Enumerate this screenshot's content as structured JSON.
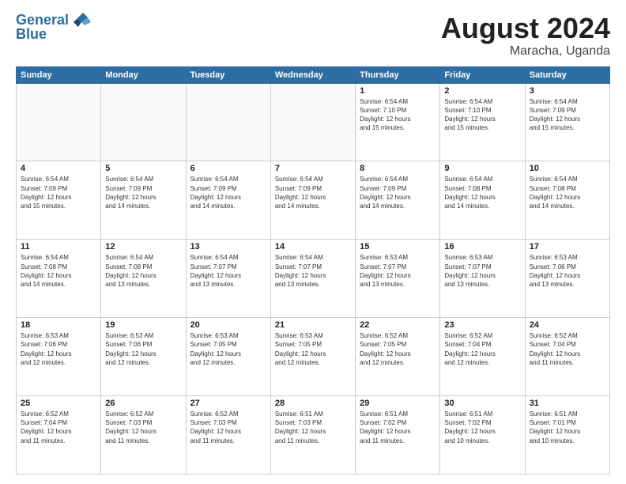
{
  "header": {
    "logo_line1": "General",
    "logo_line2": "Blue",
    "title": "August 2024",
    "subtitle": "Maracha, Uganda"
  },
  "weekdays": [
    "Sunday",
    "Monday",
    "Tuesday",
    "Wednesday",
    "Thursday",
    "Friday",
    "Saturday"
  ],
  "weeks": [
    [
      {
        "day": "",
        "info": ""
      },
      {
        "day": "",
        "info": ""
      },
      {
        "day": "",
        "info": ""
      },
      {
        "day": "",
        "info": ""
      },
      {
        "day": "1",
        "info": "Sunrise: 6:54 AM\nSunset: 7:10 PM\nDaylight: 12 hours\nand 15 minutes."
      },
      {
        "day": "2",
        "info": "Sunrise: 6:54 AM\nSunset: 7:10 PM\nDaylight: 12 hours\nand 15 minutes."
      },
      {
        "day": "3",
        "info": "Sunrise: 6:54 AM\nSunset: 7:09 PM\nDaylight: 12 hours\nand 15 minutes."
      }
    ],
    [
      {
        "day": "4",
        "info": "Sunrise: 6:54 AM\nSunset: 7:09 PM\nDaylight: 12 hours\nand 15 minutes."
      },
      {
        "day": "5",
        "info": "Sunrise: 6:54 AM\nSunset: 7:09 PM\nDaylight: 12 hours\nand 14 minutes."
      },
      {
        "day": "6",
        "info": "Sunrise: 6:54 AM\nSunset: 7:09 PM\nDaylight: 12 hours\nand 14 minutes."
      },
      {
        "day": "7",
        "info": "Sunrise: 6:54 AM\nSunset: 7:09 PM\nDaylight: 12 hours\nand 14 minutes."
      },
      {
        "day": "8",
        "info": "Sunrise: 6:54 AM\nSunset: 7:09 PM\nDaylight: 12 hours\nand 14 minutes."
      },
      {
        "day": "9",
        "info": "Sunrise: 6:54 AM\nSunset: 7:08 PM\nDaylight: 12 hours\nand 14 minutes."
      },
      {
        "day": "10",
        "info": "Sunrise: 6:54 AM\nSunset: 7:08 PM\nDaylight: 12 hours\nand 14 minutes."
      }
    ],
    [
      {
        "day": "11",
        "info": "Sunrise: 6:54 AM\nSunset: 7:08 PM\nDaylight: 12 hours\nand 14 minutes."
      },
      {
        "day": "12",
        "info": "Sunrise: 6:54 AM\nSunset: 7:08 PM\nDaylight: 12 hours\nand 13 minutes."
      },
      {
        "day": "13",
        "info": "Sunrise: 6:54 AM\nSunset: 7:07 PM\nDaylight: 12 hours\nand 13 minutes."
      },
      {
        "day": "14",
        "info": "Sunrise: 6:54 AM\nSunset: 7:07 PM\nDaylight: 12 hours\nand 13 minutes."
      },
      {
        "day": "15",
        "info": "Sunrise: 6:53 AM\nSunset: 7:07 PM\nDaylight: 12 hours\nand 13 minutes."
      },
      {
        "day": "16",
        "info": "Sunrise: 6:53 AM\nSunset: 7:07 PM\nDaylight: 12 hours\nand 13 minutes."
      },
      {
        "day": "17",
        "info": "Sunrise: 6:53 AM\nSunset: 7:06 PM\nDaylight: 12 hours\nand 13 minutes."
      }
    ],
    [
      {
        "day": "18",
        "info": "Sunrise: 6:53 AM\nSunset: 7:06 PM\nDaylight: 12 hours\nand 12 minutes."
      },
      {
        "day": "19",
        "info": "Sunrise: 6:53 AM\nSunset: 7:06 PM\nDaylight: 12 hours\nand 12 minutes."
      },
      {
        "day": "20",
        "info": "Sunrise: 6:53 AM\nSunset: 7:05 PM\nDaylight: 12 hours\nand 12 minutes."
      },
      {
        "day": "21",
        "info": "Sunrise: 6:53 AM\nSunset: 7:05 PM\nDaylight: 12 hours\nand 12 minutes."
      },
      {
        "day": "22",
        "info": "Sunrise: 6:52 AM\nSunset: 7:05 PM\nDaylight: 12 hours\nand 12 minutes."
      },
      {
        "day": "23",
        "info": "Sunrise: 6:52 AM\nSunset: 7:04 PM\nDaylight: 12 hours\nand 12 minutes."
      },
      {
        "day": "24",
        "info": "Sunrise: 6:52 AM\nSunset: 7:04 PM\nDaylight: 12 hours\nand 11 minutes."
      }
    ],
    [
      {
        "day": "25",
        "info": "Sunrise: 6:52 AM\nSunset: 7:04 PM\nDaylight: 12 hours\nand 11 minutes."
      },
      {
        "day": "26",
        "info": "Sunrise: 6:52 AM\nSunset: 7:03 PM\nDaylight: 12 hours\nand 11 minutes."
      },
      {
        "day": "27",
        "info": "Sunrise: 6:52 AM\nSunset: 7:03 PM\nDaylight: 12 hours\nand 11 minutes."
      },
      {
        "day": "28",
        "info": "Sunrise: 6:51 AM\nSunset: 7:03 PM\nDaylight: 12 hours\nand 11 minutes."
      },
      {
        "day": "29",
        "info": "Sunrise: 6:51 AM\nSunset: 7:02 PM\nDaylight: 12 hours\nand 11 minutes."
      },
      {
        "day": "30",
        "info": "Sunrise: 6:51 AM\nSunset: 7:02 PM\nDaylight: 12 hours\nand 10 minutes."
      },
      {
        "day": "31",
        "info": "Sunrise: 6:51 AM\nSunset: 7:01 PM\nDaylight: 12 hours\nand 10 minutes."
      }
    ]
  ]
}
